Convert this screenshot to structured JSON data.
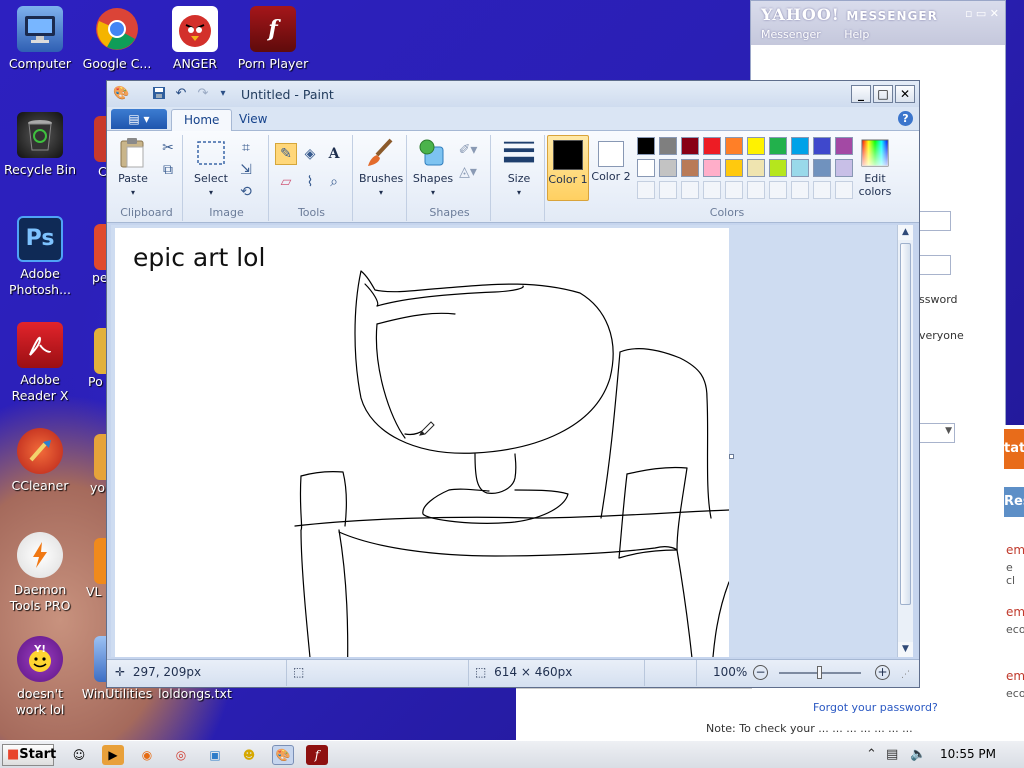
{
  "desktop": {
    "icons": [
      {
        "label": "Computer",
        "icon": "computer-icon",
        "color": "#3b6fc9"
      },
      {
        "label": "Google C...",
        "icon": "chrome-icon",
        "color": "#dd3b2f"
      },
      {
        "label": "ANGER",
        "icon": "angry-birds-icon",
        "color": "#c8302b"
      },
      {
        "label": "Porn Player",
        "icon": "flash-icon",
        "color": "#8e1010"
      },
      {
        "label": "Recycle Bin",
        "icon": "recycle-bin-icon",
        "color": "#2c2c2c"
      },
      {
        "label": "Adobe Photosh...",
        "icon": "photoshop-icon",
        "color": "#1c3d6e"
      },
      {
        "label": "Adobe Reader X",
        "icon": "adobe-reader-icon",
        "color": "#b3141a"
      },
      {
        "label": "CCleaner",
        "icon": "ccleaner-icon",
        "color": "#c7361e"
      },
      {
        "label": "Daemon Tools PRO",
        "icon": "daemon-tools-icon",
        "color": "#e86a12"
      },
      {
        "label": "doesn't work lol",
        "icon": "yahoo-messenger-icon",
        "color": "#6a1b9a"
      },
      {
        "label": "WinUtilities",
        "icon": "winutilities-icon",
        "color": "#4a7fd6"
      },
      {
        "label": "loldongs.txt",
        "icon": "text-file-icon",
        "color": "#ffffff"
      }
    ],
    "partial_labels": [
      "C",
      "pe",
      "Po",
      "yo",
      "VL"
    ]
  },
  "yahoo": {
    "logo": "YAHOO!",
    "title": "MESSENGER",
    "menu": [
      "Messenger",
      "Help"
    ],
    "texts": [
      "ssword",
      "veryone"
    ],
    "forgot_link": "Forgot your password?",
    "partial_texts": [
      "tati",
      "Res",
      "em",
      "e cl",
      "em",
      "eco",
      "em",
      "eco"
    ],
    "bottom_note": "Note: To check your ... ... ... ... ... ... ..."
  },
  "paint": {
    "title": "Untitled - Paint",
    "tabs": [
      "Home",
      "View"
    ],
    "groups": {
      "clipboard": {
        "label": "Clipboard",
        "paste": "Paste"
      },
      "image": {
        "label": "Image",
        "select": "Select"
      },
      "tools": {
        "label": "Tools"
      },
      "brushes": {
        "label": "Brushes"
      },
      "shapes": {
        "label": "Shapes",
        "shapes_btn": "Shapes"
      },
      "size": {
        "label": "Size"
      },
      "colors": {
        "label": "Colors",
        "color1": "Color 1",
        "color2": "Color 2",
        "edit": "Edit colors"
      }
    },
    "palette_row1": [
      "#000000",
      "#7f7f7f",
      "#880015",
      "#ed1c24",
      "#ff7f27",
      "#fff200",
      "#22b14c",
      "#00a2e8",
      "#3f48cc",
      "#a349a4"
    ],
    "palette_row2": [
      "#ffffff",
      "#c3c3c3",
      "#b97a57",
      "#ffaec9",
      "#ffc90e",
      "#efe4b0",
      "#b5e61d",
      "#99d9ea",
      "#7092be",
      "#c8bfe7"
    ],
    "color1_value": "#000000",
    "color2_value": "#ffffff",
    "canvas_text": "epic art lol",
    "status": {
      "cursor": "297, 209px",
      "dimensions": "614 × 460px",
      "zoom": "100%"
    }
  },
  "taskbar": {
    "start": "Start",
    "clock": "10:55 PM"
  }
}
